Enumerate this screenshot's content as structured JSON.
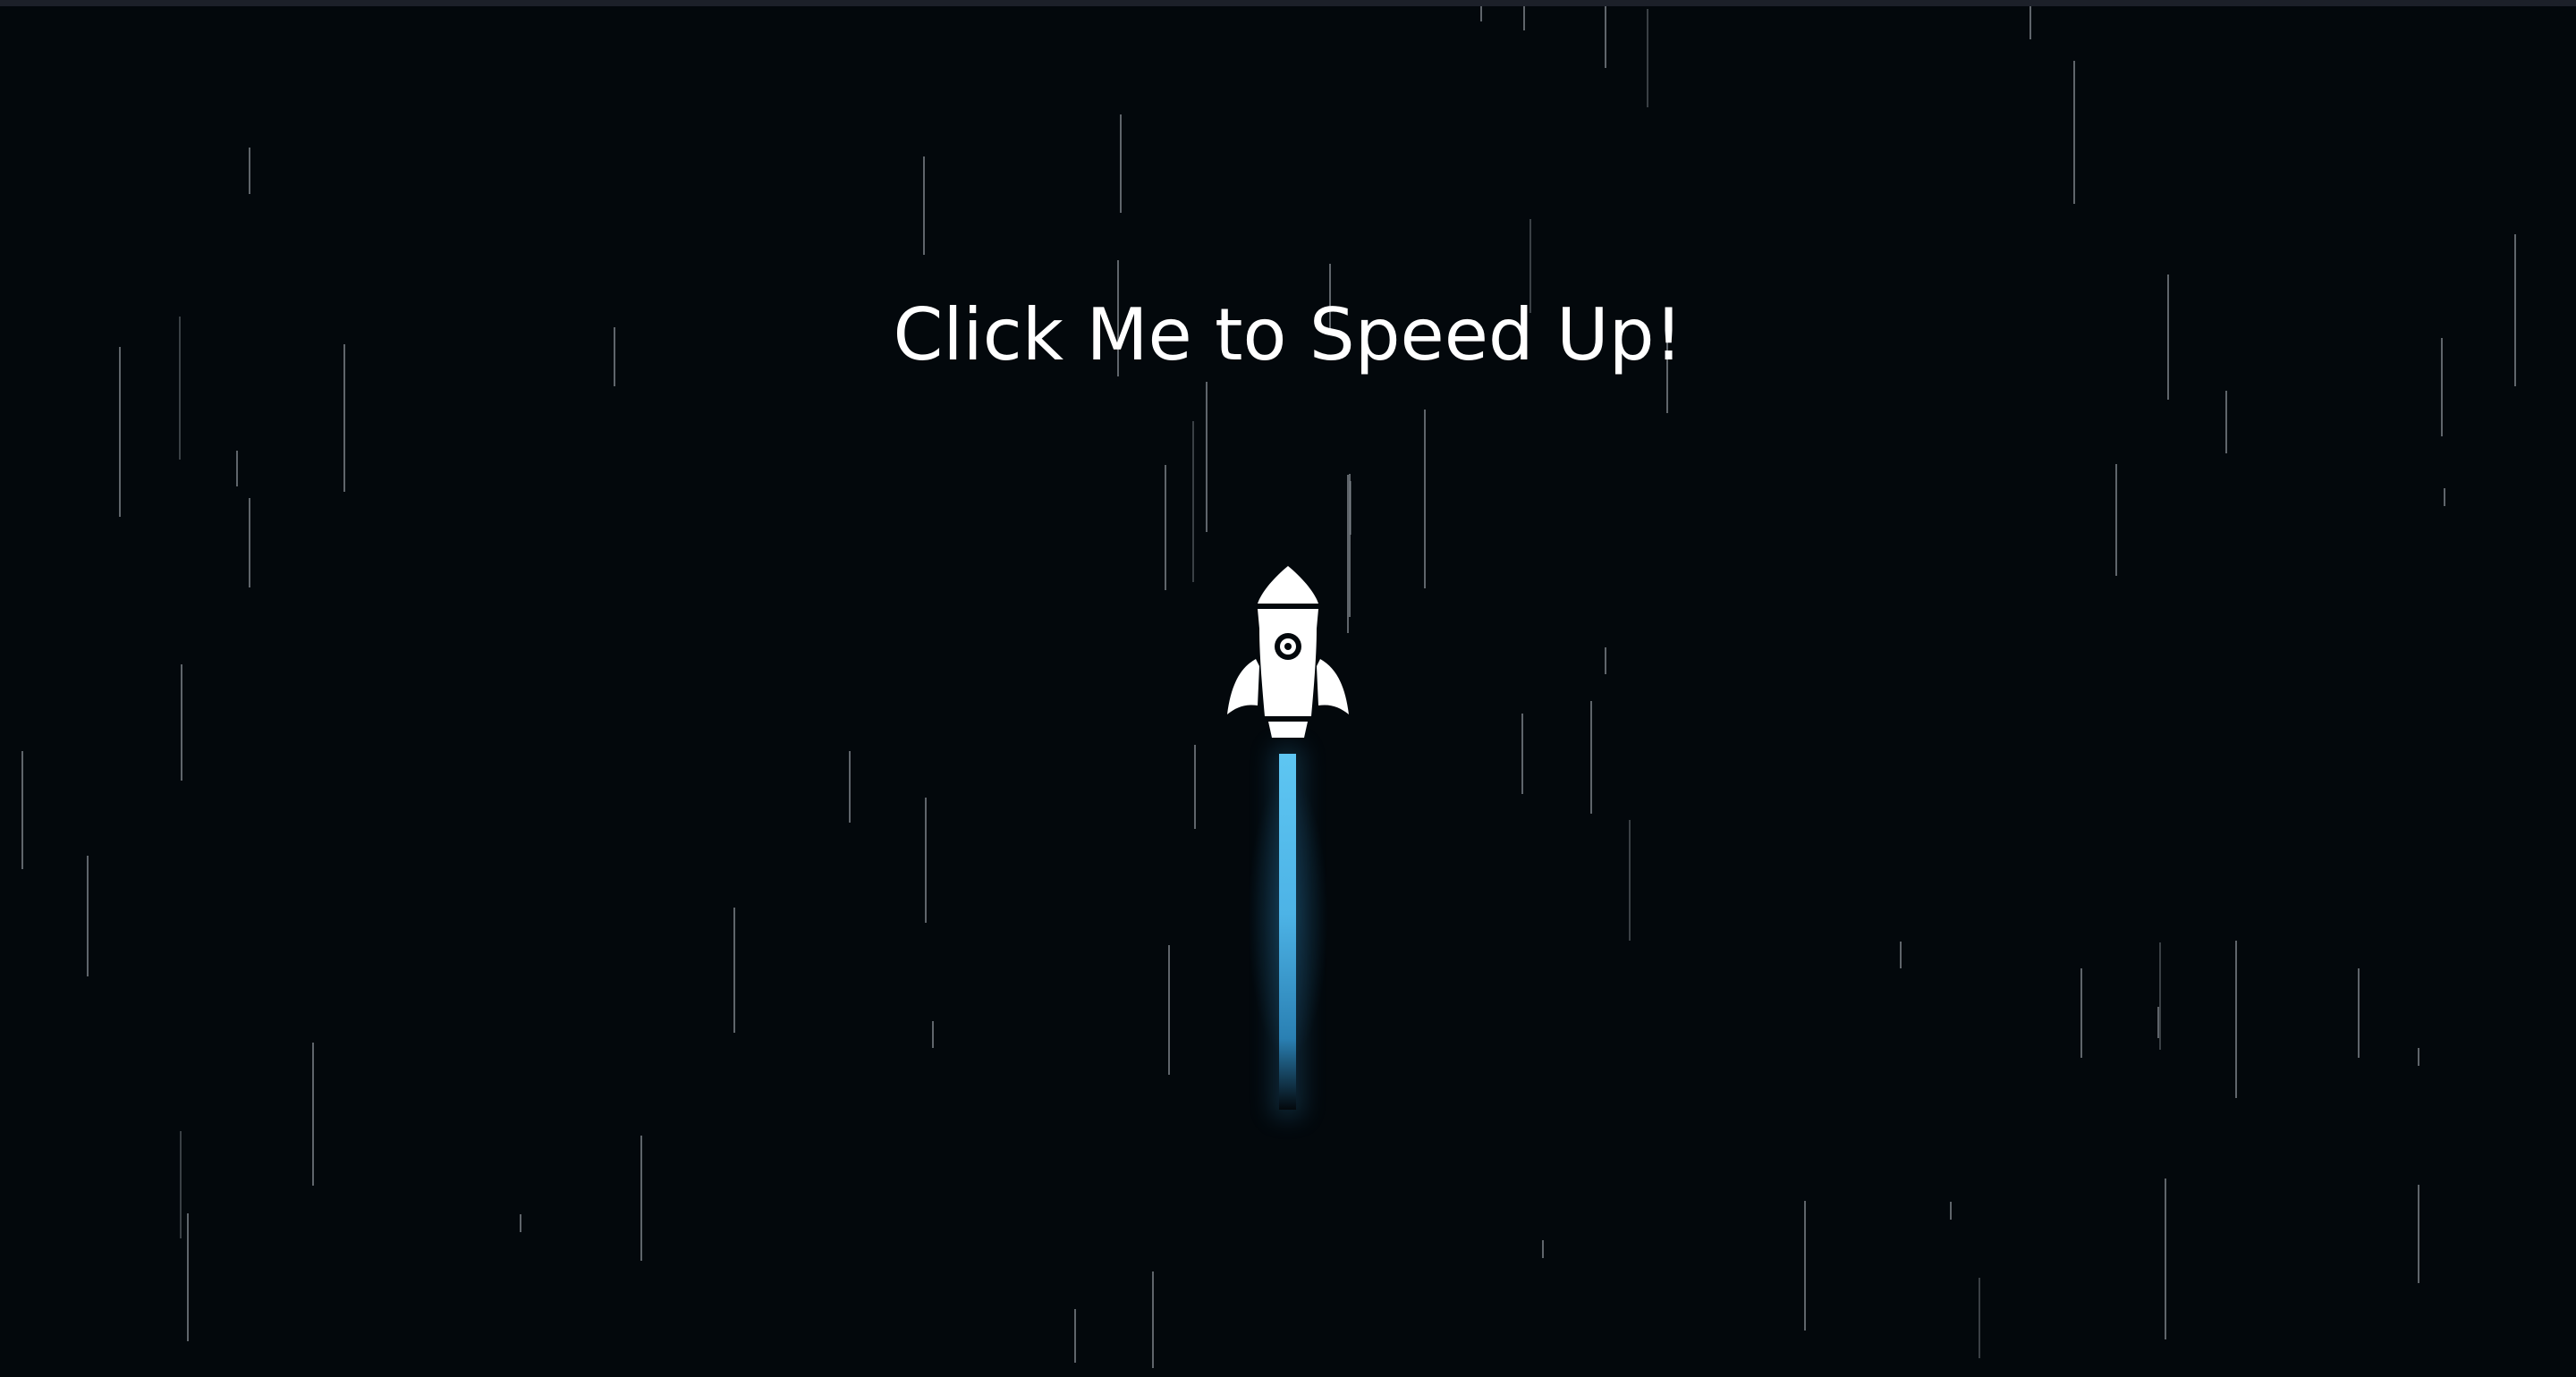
{
  "game": {
    "cta_label": "Click Me to Speed Up!"
  },
  "colors": {
    "background": "#03080c",
    "frame": "#1c2029",
    "text": "#ffffff",
    "rocket": "#ffffff",
    "flame": "#4db3e6",
    "star": "#dfe6ee"
  },
  "icons": {
    "player": "rocket-icon",
    "trail": "flame-trail"
  }
}
